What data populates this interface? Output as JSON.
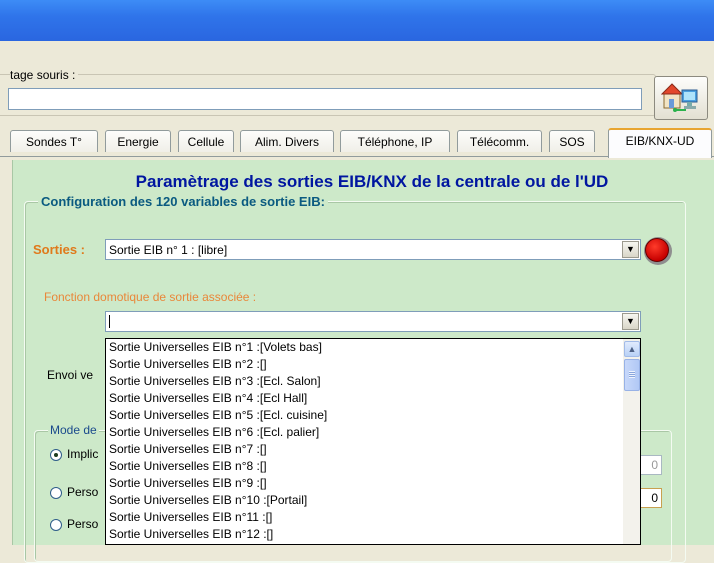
{
  "top": {
    "legend": "tage souris :",
    "input_value": ""
  },
  "tabs": [
    {
      "label": "Sondes T°"
    },
    {
      "label": "Energie"
    },
    {
      "label": "Cellule"
    },
    {
      "label": "Alim. Divers"
    },
    {
      "label": "Téléphone, IP"
    },
    {
      "label": "Télécomm."
    },
    {
      "label": "SOS"
    },
    {
      "label": "EIB/KNX-UD",
      "active": true
    }
  ],
  "panel": {
    "title": "Paramètrage des sorties EIB/KNX de la centrale ou de l'UD",
    "config_legend": "Configuration des 120 variables de sortie EIB:",
    "sorties_label": "Sorties :",
    "sorties_value": "Sortie EIB n° 1 : [libre]",
    "fonction_label": "Fonction domotique de sortie associée :",
    "fonction_value": "",
    "envoi_label": "Envoi ve",
    "mode_legend": "Mode de",
    "mode_options": [
      {
        "label": "Implic",
        "checked": true
      },
      {
        "label": "Perso",
        "checked": false
      },
      {
        "label": "Perso",
        "checked": false
      }
    ],
    "field_values": [
      "0",
      "0"
    ]
  },
  "dropdown_list": [
    "Sortie Universelles EIB n°1 :[Volets bas]",
    "Sortie Universelles EIB n°2 :[]",
    "Sortie Universelles EIB n°3 :[Ecl. Salon]",
    "Sortie Universelles EIB n°4 :[Ecl Hall]",
    "Sortie Universelles EIB n°5 :[Ecl. cuisine]",
    "Sortie Universelles EIB n°6 :[Ecl. palier]",
    "Sortie Universelles EIB n°7 :[]",
    "Sortie Universelles EIB n°8 :[]",
    "Sortie Universelles EIB n°9 :[]",
    "Sortie Universelles EIB n°10 :[Portail]",
    "Sortie Universelles EIB n°11 :[]",
    "Sortie Universelles EIB n°12 :[]"
  ],
  "colors": {
    "titlebar": "#2f74ea",
    "panel_bg": "#cde9c9",
    "title_text": "#0016a0",
    "sorties_label": "#e07a1b",
    "led": "#e00000"
  },
  "icons": {
    "home_network": "home-network-icon",
    "status_led": "status-led-icon"
  }
}
